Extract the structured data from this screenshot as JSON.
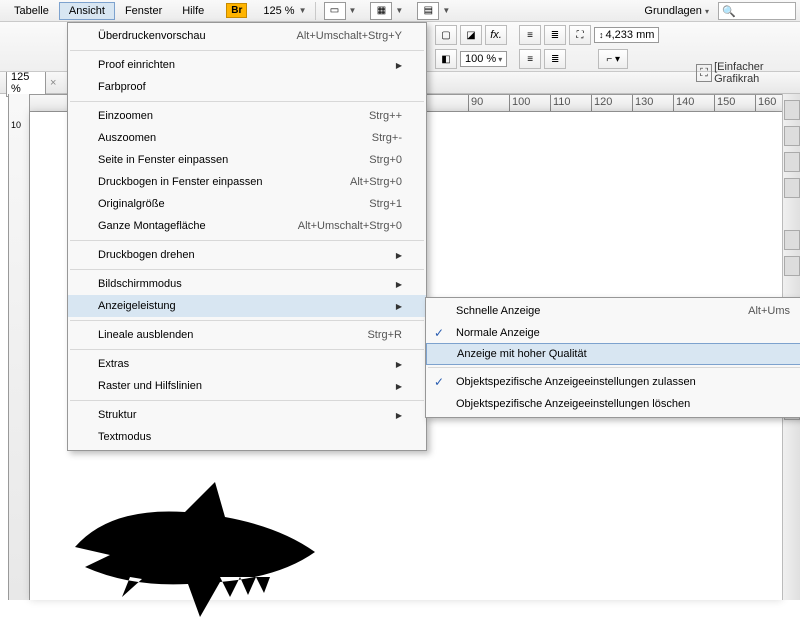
{
  "menubar": {
    "items": [
      "Tabelle",
      "Ansicht",
      "Fenster",
      "Hilfe"
    ],
    "br_badge": "Br",
    "zoom": "125 %"
  },
  "toolbar": {
    "mm_value": "4,233 mm",
    "hundred": "100 %",
    "grundlagen": "Grundlagen",
    "graphics": "[Einfacher Grafikrah"
  },
  "zoom_control": "125 %",
  "ruler_labels": [
    "90",
    "100",
    "110",
    "120",
    "130",
    "140",
    "150",
    "160"
  ],
  "side_ruler": "10",
  "view_menu": [
    {
      "label": "Überdruckenvorschau",
      "shortcut": "Alt+Umschalt+Strg+Y"
    },
    null,
    {
      "label": "Proof einrichten",
      "submenu": true
    },
    {
      "label": "Farbproof"
    },
    null,
    {
      "label": "Einzoomen",
      "shortcut": "Strg++"
    },
    {
      "label": "Auszoomen",
      "shortcut": "Strg+-"
    },
    {
      "label": "Seite in Fenster einpassen",
      "shortcut": "Strg+0"
    },
    {
      "label": "Druckbogen in Fenster einpassen",
      "shortcut": "Alt+Strg+0"
    },
    {
      "label": "Originalgröße",
      "shortcut": "Strg+1"
    },
    {
      "label": "Ganze Montagefläche",
      "shortcut": "Alt+Umschalt+Strg+0"
    },
    null,
    {
      "label": "Druckbogen drehen",
      "submenu": true
    },
    null,
    {
      "label": "Bildschirmmodus",
      "submenu": true
    },
    {
      "label": "Anzeigeleistung",
      "submenu": true,
      "active": true
    },
    null,
    {
      "label": "Lineale ausblenden",
      "shortcut": "Strg+R"
    },
    null,
    {
      "label": "Extras",
      "submenu": true
    },
    {
      "label": "Raster und Hilfslinien",
      "submenu": true
    },
    null,
    {
      "label": "Struktur",
      "submenu": true
    },
    {
      "label": "Textmodus"
    }
  ],
  "display_submenu": [
    {
      "label": "Schnelle Anzeige",
      "shortcut": "Alt+Ums"
    },
    {
      "label": "Normale Anzeige",
      "checked": true
    },
    {
      "label": "Anzeige mit hoher Qualität",
      "highlight": true
    },
    null,
    {
      "label": "Objektspezifische Anzeigeeinstellungen zulassen",
      "checked": true
    },
    {
      "label": "Objektspezifische Anzeigeeinstellungen löschen"
    }
  ]
}
